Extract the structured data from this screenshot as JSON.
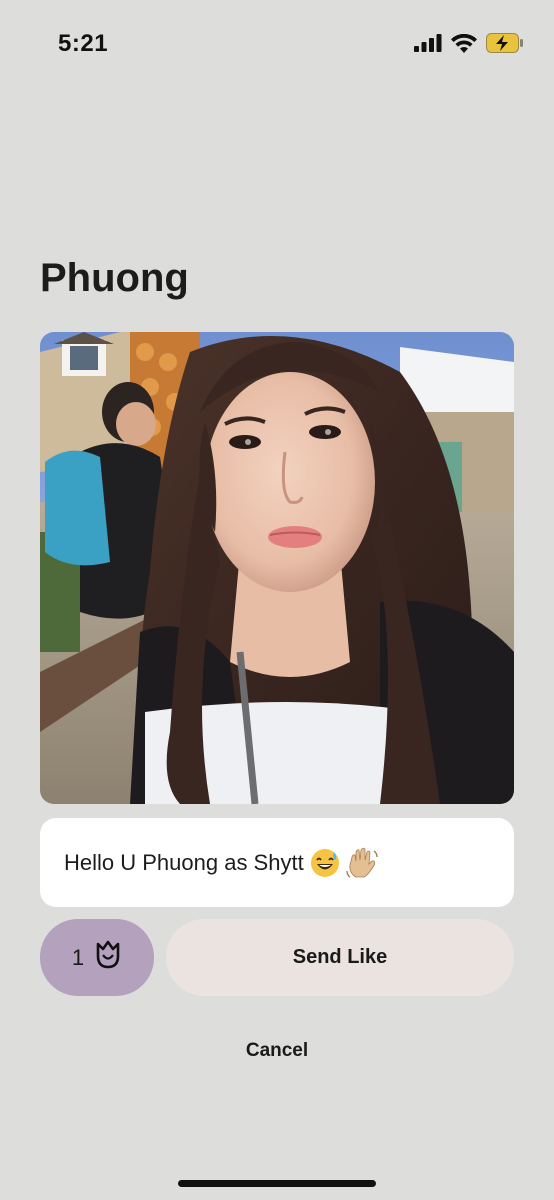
{
  "status_bar": {
    "time": "5:21",
    "icons": [
      "cellular-signal-icon",
      "wifi-icon",
      "battery-charging-icon"
    ]
  },
  "profile": {
    "name": "Phuong",
    "photo_description": "selfie-photo"
  },
  "comment": {
    "text": "Hello U Phuong as Shytt",
    "emojis": [
      "grinning-sweat-emoji",
      "waving-hand-emoji"
    ]
  },
  "actions": {
    "rose_count": "1",
    "send_like_label": "Send Like",
    "cancel_label": "Cancel"
  },
  "colors": {
    "background": "#dddddc",
    "rose_button": "#b4a1bd",
    "send_like_button": "#ebe3df",
    "comment_box": "#ffffff"
  }
}
